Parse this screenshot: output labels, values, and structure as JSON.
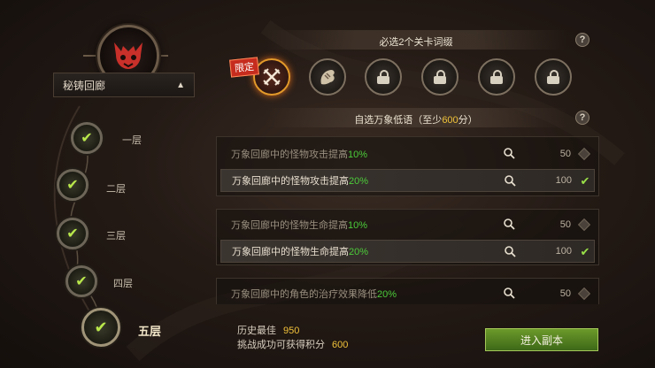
{
  "zone": {
    "name": "秘铸回廊",
    "chevron": "chevron-up-icon"
  },
  "floors": [
    {
      "label": "一层",
      "completed": true
    },
    {
      "label": "二层",
      "completed": true
    },
    {
      "label": "三层",
      "completed": true
    },
    {
      "label": "四层",
      "completed": true
    },
    {
      "label": "五层",
      "completed": true,
      "current": true
    }
  ],
  "stage_affix": {
    "title": "必选2个关卡词缀",
    "help": "?",
    "limited_tag": "限定",
    "slots": [
      {
        "icon": "crossed-swords-icon",
        "selected": true,
        "locked": false
      },
      {
        "icon": "beast-claw-icon",
        "selected": false,
        "locked": false
      },
      {
        "icon": "lock-icon",
        "locked": true
      },
      {
        "icon": "lock-icon",
        "locked": true
      },
      {
        "icon": "lock-icon",
        "locked": true
      },
      {
        "icon": "lock-icon",
        "locked": true
      }
    ]
  },
  "whispers": {
    "title_prefix": "自选万象低语（至少",
    "title_value": "600",
    "title_suffix": "分）",
    "help": "?",
    "groups": [
      {
        "rows": [
          {
            "text": "万象回廊中的怪物攻击提高",
            "pct": "10%",
            "points": "50",
            "selected": false
          },
          {
            "text": "万象回廊中的怪物攻击提高",
            "pct": "20%",
            "points": "100",
            "selected": true
          }
        ]
      },
      {
        "rows": [
          {
            "text": "万象回廊中的怪物生命提高",
            "pct": "10%",
            "points": "50",
            "selected": false
          },
          {
            "text": "万象回廊中的怪物生命提高",
            "pct": "20%",
            "points": "100",
            "selected": true
          }
        ]
      },
      {
        "rows": [
          {
            "text": "万象回廊中的角色的治疗效果降低",
            "pct": "20%",
            "points": "50",
            "selected": false
          }
        ]
      }
    ]
  },
  "stats": {
    "best_label": "历史最佳",
    "best_value": "950",
    "reward_label": "挑战成功可获得积分",
    "reward_value": "600"
  },
  "enter_button": "进入副本",
  "colors": {
    "accent_green": "#4bcb3a",
    "gold": "#f0c23a",
    "selected_ring": "#e39a2a"
  }
}
